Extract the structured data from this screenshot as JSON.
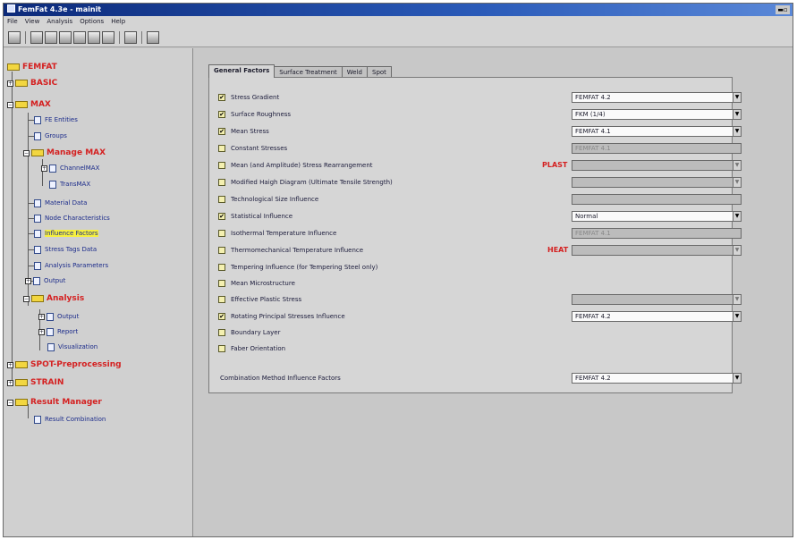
{
  "window": {
    "title": "FemFat 4.3e - mainit"
  },
  "menu": [
    "File",
    "View",
    "Analysis",
    "Options",
    "Help"
  ],
  "tree": {
    "femfat": "FEMFAT",
    "basic": "BASIC",
    "max": "MAX",
    "fe_entities": "FE Entities",
    "groups": "Groups",
    "manage_max": "Manage MAX",
    "channel_max": "ChannelMAX",
    "transmax": "TransMAX",
    "material_data": "Material Data",
    "node_characteristics": "Node Characteristics",
    "influence_factors": "Influence Factors",
    "stress_tags_data": "Stress Tags Data",
    "analysis_parameters": "Analysis Parameters",
    "output": "Output",
    "analysis": "Analysis",
    "analysis_output": "Output",
    "analysis_report": "Report",
    "visualization": "Visualization",
    "spot_preprocessing": "SPOT-Preprocessing",
    "strain": "STRAIN",
    "result_manager": "Result Manager",
    "result_combination": "Result Combination"
  },
  "tabs": [
    "General Factors",
    "Surface Treatment",
    "Weld",
    "Spot"
  ],
  "factors": [
    {
      "label": "Stress Gradient",
      "checked": true,
      "dropdown": "FEMFAT 4.2",
      "disabled": false
    },
    {
      "label": "Surface Roughness",
      "checked": true,
      "dropdown": "FKM (1/4)",
      "disabled": false
    },
    {
      "label": "Mean Stress",
      "checked": true,
      "dropdown": "FEMFAT 4.1",
      "disabled": false
    },
    {
      "label": "Constant Stresses",
      "checked": false,
      "dropdown": "FEMFAT 4.1",
      "disabled": true
    },
    {
      "label": "Mean (and Amplitude) Stress Rearrangement",
      "checked": false,
      "dropdown": "",
      "disabled": true,
      "tag": "PLAST"
    },
    {
      "label": "Modified Haigh Diagram (Ultimate Tensile Strength)",
      "checked": false,
      "dropdown": "",
      "disabled": true
    },
    {
      "label": "Technological Size Influence",
      "checked": false,
      "dropdown": "",
      "disabled": true
    },
    {
      "label": "Statistical Influence",
      "checked": true,
      "dropdown": "Normal",
      "disabled": false
    },
    {
      "label": "Isothermal Temperature Influence",
      "checked": false,
      "dropdown": "FEMFAT 4.1",
      "disabled": true
    },
    {
      "label": "Thermomechanical Temperature Influence",
      "checked": false,
      "dropdown": "",
      "disabled": true,
      "tag": "HEAT"
    },
    {
      "label": "Tempering Influence (for Tempering Steel only)",
      "checked": false
    },
    {
      "label": "Mean Microstructure",
      "checked": false
    },
    {
      "label": "Effective Plastic Stress",
      "checked": false,
      "dropdown": "",
      "disabled": true
    },
    {
      "label": "Rotating Principal Stresses Influence",
      "checked": true,
      "dropdown": "FEMFAT 4.2",
      "disabled": false
    },
    {
      "label": "Boundary Layer",
      "checked": false
    },
    {
      "label": "Faber Orientation",
      "checked": false
    }
  ],
  "combination": {
    "label": "Combination Method Influence Factors",
    "value": "FEMFAT 4.2"
  },
  "colors": {
    "accent_red": "#d42020",
    "tree_blue": "#1a2a8a",
    "selection": "#f6f040"
  }
}
